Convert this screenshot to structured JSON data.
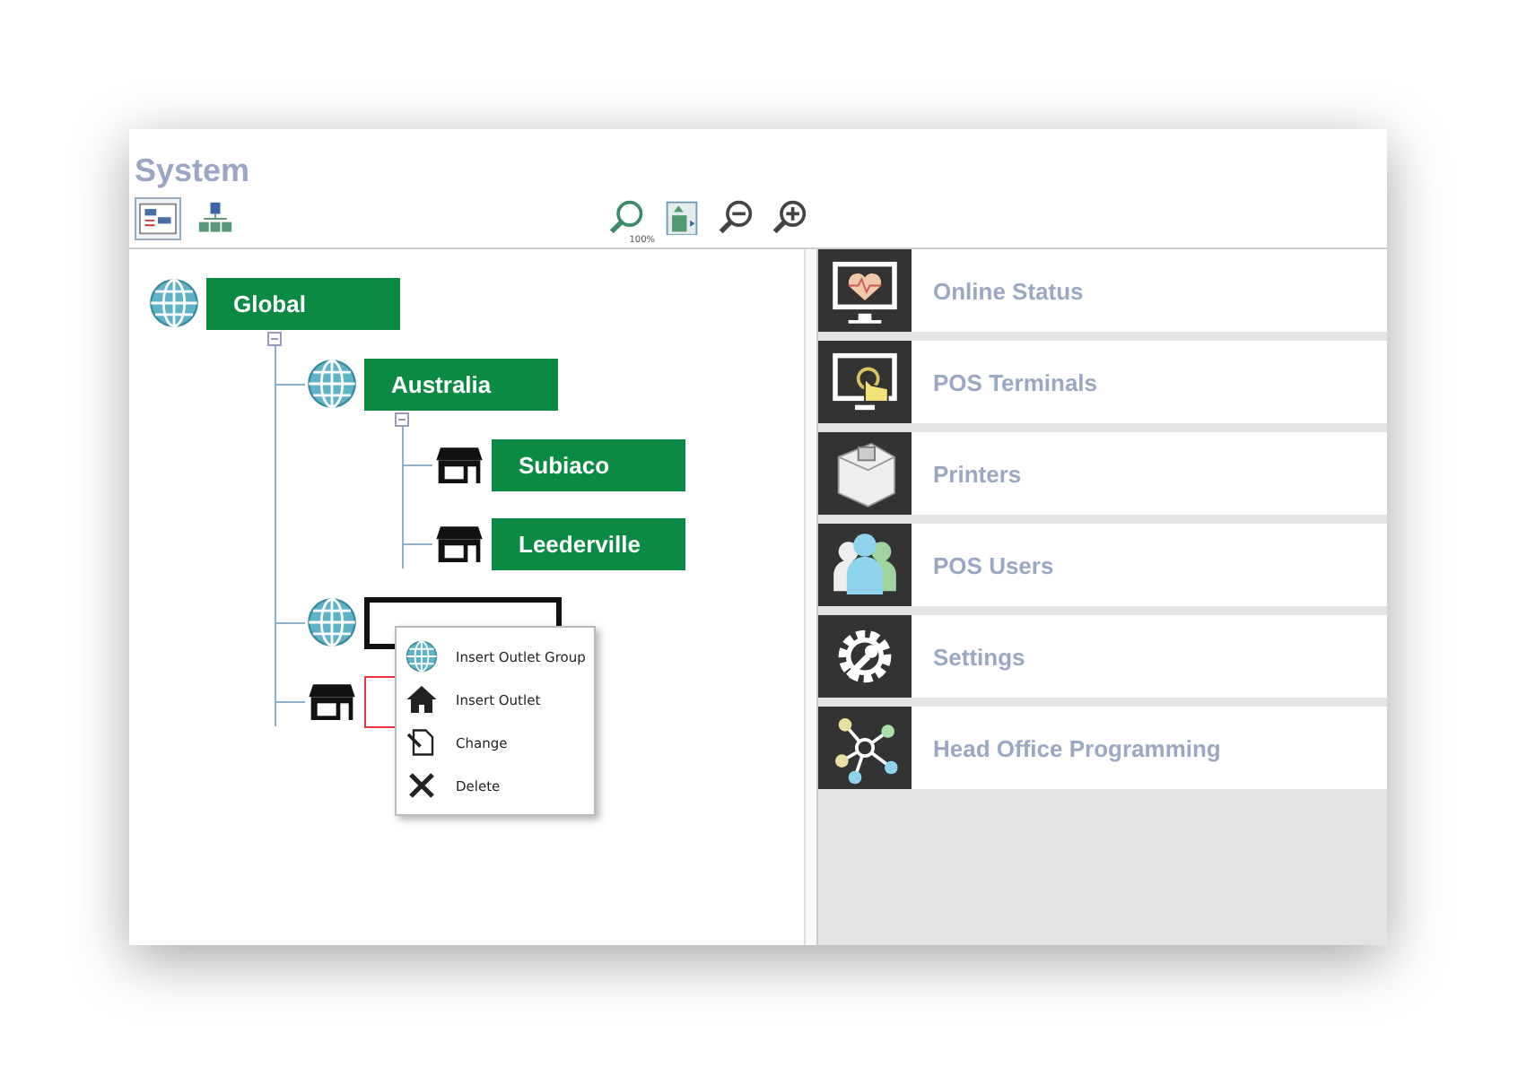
{
  "window": {
    "title": "System"
  },
  "toolbar": {
    "left": [
      {
        "kind": "outline",
        "selected": true
      },
      {
        "kind": "hierarchy",
        "selected": false
      }
    ],
    "right": [
      {
        "kind": "zoom-reset",
        "label": "100%"
      },
      {
        "kind": "fit"
      },
      {
        "kind": "zoom-out"
      },
      {
        "kind": "zoom-in"
      }
    ]
  },
  "tree": [
    {
      "kind": "group",
      "label": "Global",
      "selected": false,
      "marked": false,
      "children": [
        {
          "kind": "group",
          "label": "Australia",
          "selected": false,
          "marked": false,
          "children": [
            {
              "kind": "outlet",
              "label": "Subiaco",
              "selected": false,
              "marked": false
            },
            {
              "kind": "outlet",
              "label": "Leederville",
              "selected": false,
              "marked": false
            }
          ]
        },
        {
          "kind": "group",
          "selected": true,
          "marked": false
        },
        {
          "kind": "outlet",
          "selected": false,
          "marked": true
        }
      ]
    }
  ],
  "context_menu": [
    {
      "kind": "group",
      "label": "Insert Outlet Group"
    },
    {
      "kind": "outlet",
      "label": "Insert Outlet"
    },
    {
      "kind": "change",
      "label": "Change"
    },
    {
      "kind": "delete",
      "label": "Delete"
    }
  ],
  "menu": [
    {
      "kind": "status",
      "label": "Online Status"
    },
    {
      "kind": "terminal",
      "label": "POS Terminals"
    },
    {
      "kind": "printer",
      "label": "Printers"
    },
    {
      "kind": "users",
      "label": "POS Users"
    },
    {
      "kind": "settings",
      "label": "Settings"
    },
    {
      "kind": "network",
      "label": "Head Office Programming"
    }
  ]
}
